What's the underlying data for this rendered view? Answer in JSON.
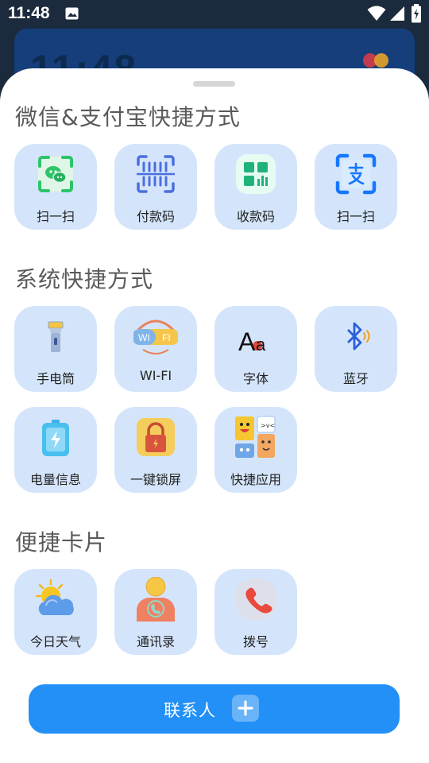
{
  "status_bar": {
    "time": "11:48",
    "icons": [
      "gallery-icon",
      "wifi-icon",
      "signal-icon",
      "battery-charging-icon"
    ]
  },
  "background_card": {
    "clock": "11:48"
  },
  "sections": [
    {
      "title": "微信&支付宝快捷方式",
      "items": [
        {
          "label": "扫一扫",
          "icon": "wechat-scan-icon"
        },
        {
          "label": "付款码",
          "icon": "barcode-icon"
        },
        {
          "label": "收款码",
          "icon": "qr-collect-icon"
        },
        {
          "label": "扫一扫",
          "icon": "alipay-scan-icon"
        }
      ]
    },
    {
      "title": "系统快捷方式",
      "items": [
        {
          "label": "手电筒",
          "icon": "flashlight-icon"
        },
        {
          "label": "WI-FI",
          "icon": "wifi-toggle-icon"
        },
        {
          "label": "字体",
          "icon": "font-icon"
        },
        {
          "label": "蓝牙",
          "icon": "bluetooth-icon"
        },
        {
          "label": "电量信息",
          "icon": "battery-info-icon"
        },
        {
          "label": "一键锁屏",
          "icon": "lock-icon"
        },
        {
          "label": "快捷应用",
          "icon": "apps-icon"
        }
      ]
    },
    {
      "title": "便捷卡片",
      "items": [
        {
          "label": "今日天气",
          "icon": "weather-icon"
        },
        {
          "label": "通讯录",
          "icon": "contacts-icon"
        },
        {
          "label": "拨号",
          "icon": "phone-icon"
        }
      ]
    }
  ],
  "contact_button": {
    "label": "联系人",
    "icon": "plus-icon"
  },
  "colors": {
    "tile_bg": "#d4e5fb",
    "accent_blue": "#2290f6",
    "wechat_green": "#2ec46a",
    "alipay_blue": "#1677ff",
    "title_gray": "#5a5a5a"
  }
}
